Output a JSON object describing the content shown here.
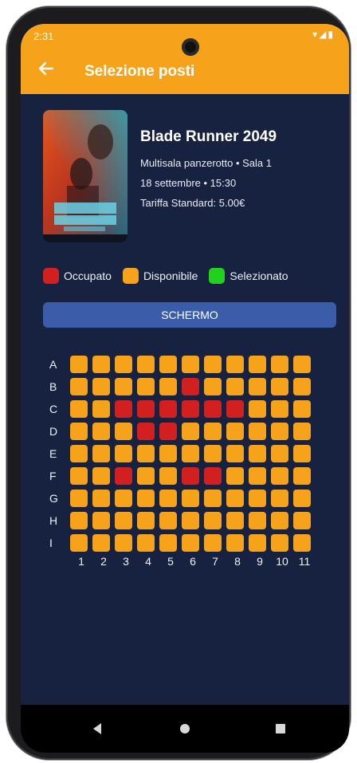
{
  "status": {
    "time": "2:31",
    "icons": "▾◢▮"
  },
  "appbar": {
    "title": "Selezione posti",
    "back_icon": "arrow-left-icon"
  },
  "movie": {
    "title": "Blade Runner 2049",
    "cinema": "Multisala panzerotto • Sala 1",
    "datetime": "18 settembre • 15:30",
    "tariff": "Tariffa Standard: 5.00€"
  },
  "legend": [
    {
      "label": "Occupato",
      "color": "#d21f1f"
    },
    {
      "label": "Disponibile",
      "color": "#f7a21b"
    },
    {
      "label": "Selezionato",
      "color": "#22d11d"
    }
  ],
  "screen_label": "SCHERMO",
  "colors": {
    "occupied": "#d21f1f",
    "available": "#f7a21b",
    "selected": "#22d11d",
    "appbar": "#f7a21b"
  },
  "rows": [
    "A",
    "B",
    "C",
    "D",
    "E",
    "F",
    "G",
    "H",
    "I"
  ],
  "columns": [
    "1",
    "2",
    "3",
    "4",
    "5",
    "6",
    "7",
    "8",
    "9",
    "10",
    "11"
  ],
  "occupied": {
    "A": [],
    "B": [
      6
    ],
    "C": [
      3,
      4,
      5,
      6,
      7,
      8
    ],
    "D": [
      4,
      5
    ],
    "E": [],
    "F": [
      3,
      6,
      7
    ],
    "G": [],
    "H": [],
    "I": []
  }
}
